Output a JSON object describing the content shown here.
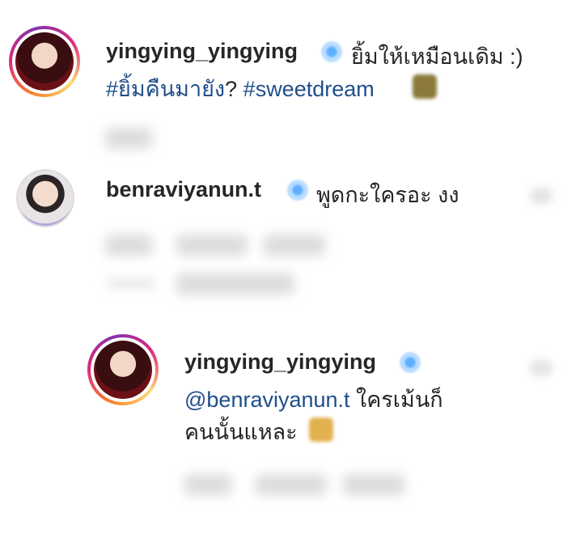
{
  "comments": [
    {
      "username": "yingying_yingying",
      "text_part1": "ยิ้มให้เหมือนเดิม :)",
      "hashtag1": "#ยิ้มคืนมายัง",
      "text_part2": "?",
      "hashtag2": "#sweetdream"
    },
    {
      "username": "benraviyanun.t",
      "text": "พูดกะใครอะ งง"
    },
    {
      "username": "yingying_yingying",
      "mention": "@benraviyanun.t",
      "text_line1": "ใครเม้นก็",
      "text_line2": "คนนั้นแหละ"
    }
  ],
  "icons": [
    "verified-badge-icon",
    "emoji-icon",
    "heart-icon"
  ],
  "colors": {
    "link": "#1f4f8b",
    "text": "#262626",
    "verified": "#5eb0ff"
  }
}
